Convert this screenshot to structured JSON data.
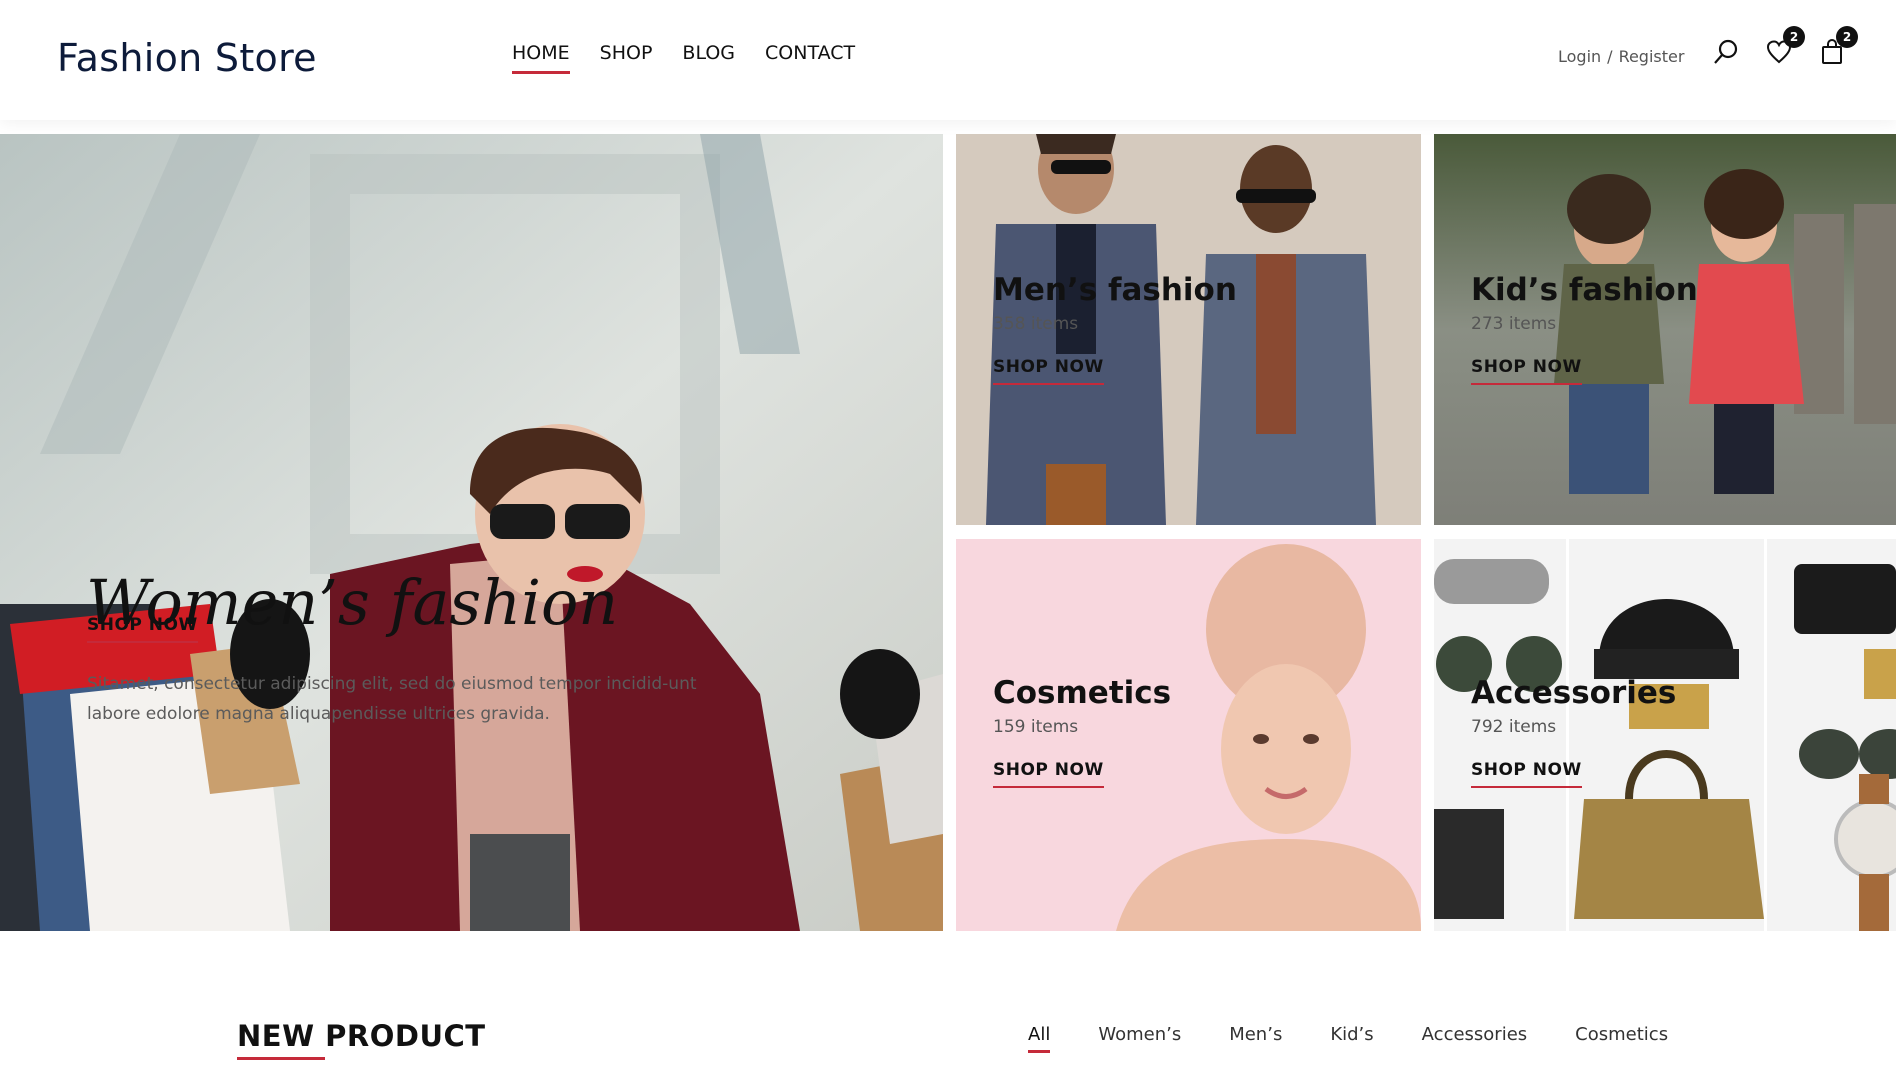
{
  "header": {
    "logo": "Fashion Store",
    "nav": [
      {
        "label": "HOME",
        "active": true
      },
      {
        "label": "SHOP",
        "active": false
      },
      {
        "label": "BLOG",
        "active": false
      },
      {
        "label": "CONTACT",
        "active": false
      }
    ],
    "login_label": "Login",
    "separator": "/",
    "register_label": "Register",
    "icons": {
      "search": "search-icon",
      "wishlist": "heart-icon",
      "cart": "shopping-bag-icon"
    },
    "wishlist_count": "2",
    "cart_count": "2"
  },
  "banners": {
    "women": {
      "title": "Women’s fashion",
      "description": "Sitamet, consectetur adipiscing elit, sed do eiusmod tempor incidid-unt labore edolore magna aliquapendisse ultrices gravida.",
      "cta": "SHOP NOW"
    },
    "men": {
      "title": "Men’s fashion",
      "count": "358 items",
      "cta": "SHOP NOW"
    },
    "kids": {
      "title": "Kid’s fashion",
      "count": "273 items",
      "cta": "SHOP NOW"
    },
    "cosmetics": {
      "title": "Cosmetics",
      "count": "159 items",
      "cta": "SHOP NOW"
    },
    "accessories": {
      "title": "Accessories",
      "count": "792 items",
      "cta": "SHOP NOW"
    }
  },
  "new_product": {
    "title": "NEW PRODUCT",
    "filters": [
      {
        "label": "All",
        "active": true
      },
      {
        "label": "Women’s",
        "active": false
      },
      {
        "label": "Men’s",
        "active": false
      },
      {
        "label": "Kid’s",
        "active": false
      },
      {
        "label": "Accessories",
        "active": false
      },
      {
        "label": "Cosmetics",
        "active": false
      }
    ]
  },
  "colors": {
    "accent": "#c52a3a",
    "logo": "#0d1b3a",
    "cosmetics_bg": "#f8d7de"
  }
}
